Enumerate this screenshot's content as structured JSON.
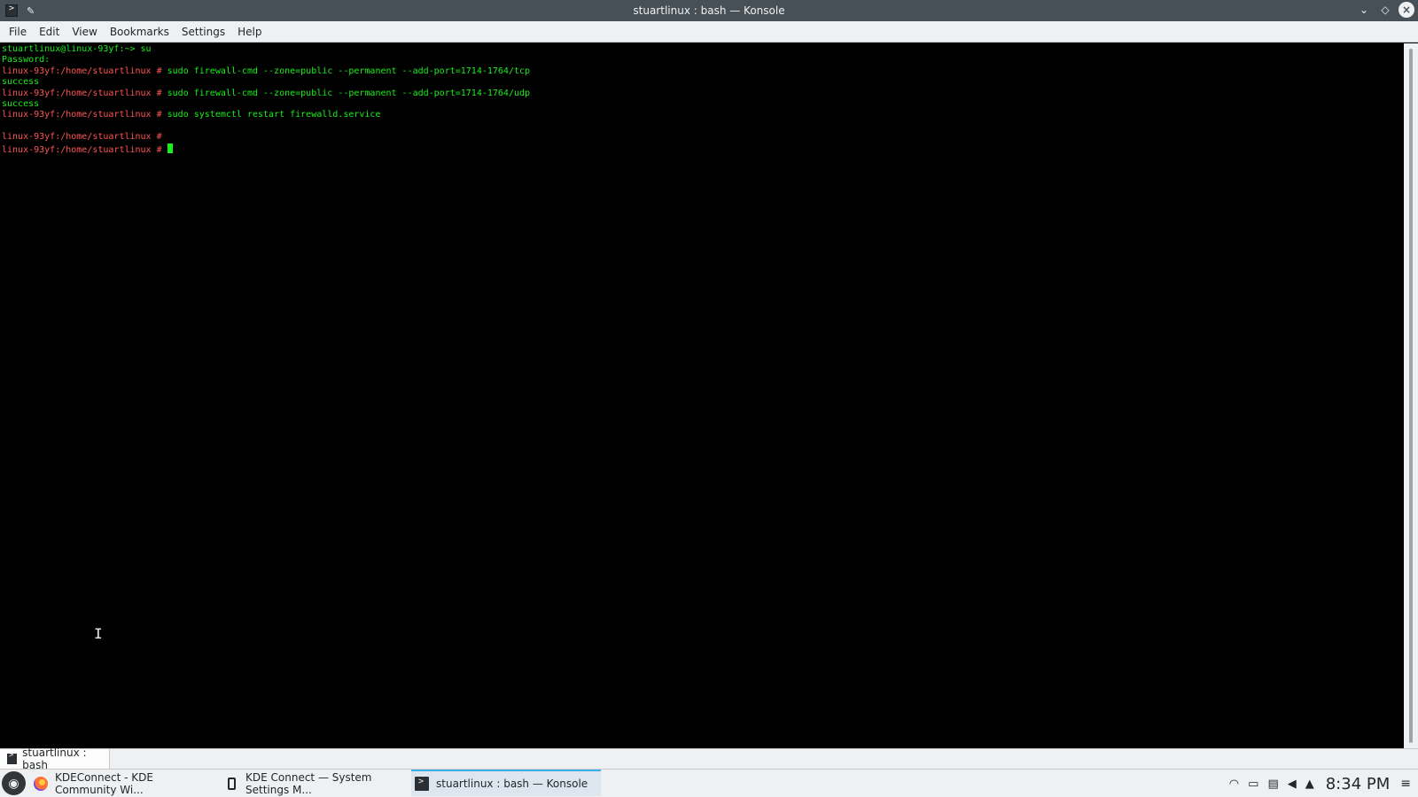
{
  "window": {
    "title": "stuartlinux : bash — Konsole"
  },
  "menubar": {
    "items": [
      "File",
      "Edit",
      "View",
      "Bookmarks",
      "Settings",
      "Help"
    ]
  },
  "terminal": {
    "lines": [
      {
        "parts": [
          {
            "text": "stuartlinux@linux-93yf:~> su",
            "color": "green"
          }
        ]
      },
      {
        "parts": [
          {
            "text": "Password:",
            "color": "green"
          }
        ]
      },
      {
        "parts": [
          {
            "text": "linux-93yf:/home/stuartlinux # ",
            "color": "red"
          },
          {
            "text": "sudo firewall-cmd --zone=public --permanent --add-port=1714-1764/tcp",
            "color": "green"
          }
        ]
      },
      {
        "parts": [
          {
            "text": "success",
            "color": "green"
          }
        ]
      },
      {
        "parts": [
          {
            "text": "linux-93yf:/home/stuartlinux # ",
            "color": "red"
          },
          {
            "text": "sudo firewall-cmd --zone=public --permanent --add-port=1714-1764/udp",
            "color": "green"
          }
        ]
      },
      {
        "parts": [
          {
            "text": "success",
            "color": "green"
          }
        ]
      },
      {
        "parts": [
          {
            "text": "linux-93yf:/home/stuartlinux # ",
            "color": "red"
          },
          {
            "text": "sudo systemctl restart firewalld.service",
            "color": "green"
          }
        ]
      },
      {
        "parts": []
      },
      {
        "parts": [
          {
            "text": "linux-93yf:/home/stuartlinux #",
            "color": "red"
          }
        ]
      },
      {
        "parts": [
          {
            "text": "linux-93yf:/home/stuartlinux # ",
            "color": "red"
          }
        ],
        "cursor": true
      }
    ]
  },
  "tabbar": {
    "tab_label": "stuartlinux : bash"
  },
  "taskbar": {
    "tasks": [
      {
        "label": "KDEConnect - KDE Community Wi...",
        "icon": "firefox-icon"
      },
      {
        "label": "KDE Connect — System Settings M...",
        "icon": "phone-icon"
      },
      {
        "label": "stuartlinux : bash — Konsole",
        "icon": "konsole-icon"
      }
    ],
    "clock": "8:34 PM"
  }
}
